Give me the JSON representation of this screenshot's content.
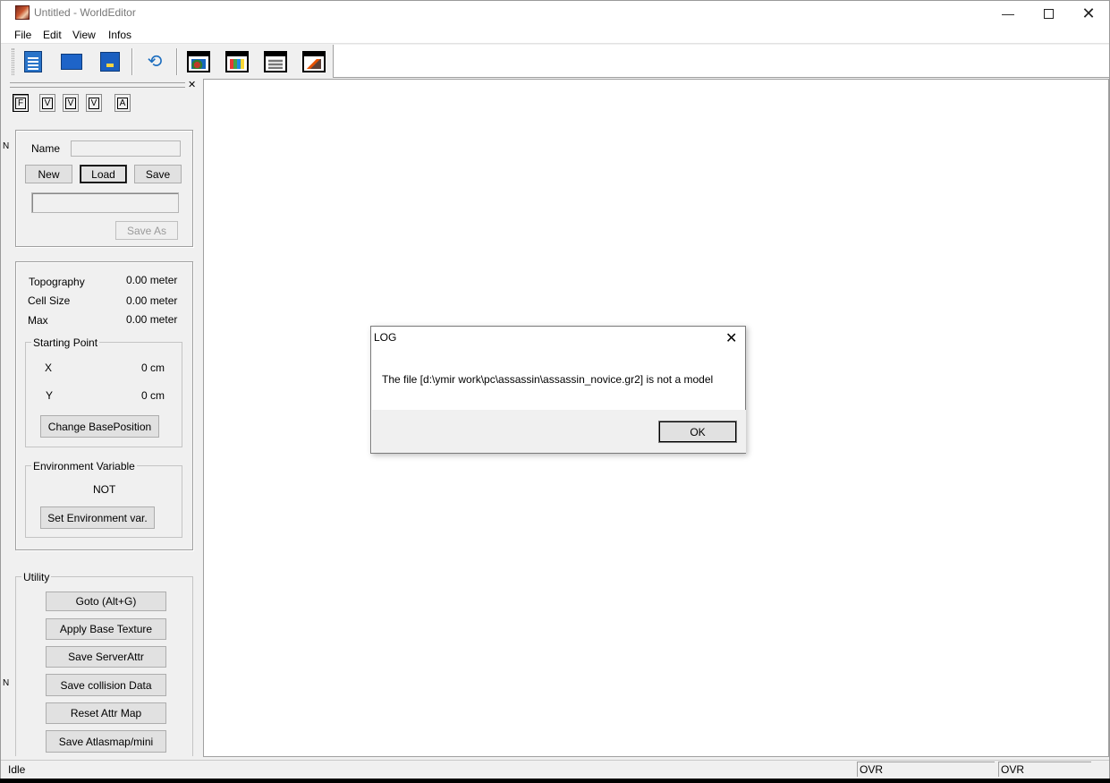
{
  "window": {
    "title": "Untitled - WorldEditor"
  },
  "menu": [
    "File",
    "Edit",
    "View",
    "Infos"
  ],
  "toolbar": {
    "buttons": [
      "new-file-icon",
      "open-folder-icon",
      "save-icon",
      "undo-icon",
      "object-window-icon",
      "texture-window-icon",
      "attribute-window-icon",
      "brush-window-icon"
    ]
  },
  "left_panel": {
    "tabs": [
      "F",
      "V",
      "V",
      "V",
      "A"
    ],
    "file_group": {
      "name_label": "Name",
      "name_value": "",
      "new_label": "New",
      "load_label": "Load",
      "save_label": "Save",
      "path_value": "",
      "save_as_label": "Save As"
    },
    "info_group": {
      "topography_label": "Topography",
      "topography_value": "0.00 meter",
      "cellsize_label": "Cell Size",
      "cellsize_value": "0.00 meter",
      "max_label": "Max",
      "max_value": "0.00 meter",
      "starting_point_title": "Starting Point",
      "x_label": "X",
      "x_value": "0 cm",
      "y_label": "Y",
      "y_value": "0 cm",
      "change_base_label": "Change BasePosition",
      "env_title": "Environment Variable",
      "env_value": "NOT",
      "set_env_label": "Set Environment var."
    },
    "utility": {
      "title": "Utility",
      "buttons": [
        "Goto (Alt+G)",
        "Apply Base Texture",
        "Save ServerAttr",
        "Save collision Data",
        "Reset Attr Map",
        "Save Atlasmap/mini"
      ]
    }
  },
  "dialog": {
    "title": "LOG",
    "message": "The file [d:\\ymir work\\pc\\assassin\\assassin_novice.gr2] is not a model",
    "ok_label": "OK"
  },
  "statusbar": {
    "status": "Idle",
    "pane1": "OVR",
    "pane2": "OVR"
  },
  "side_marks": [
    "N",
    "N"
  ]
}
